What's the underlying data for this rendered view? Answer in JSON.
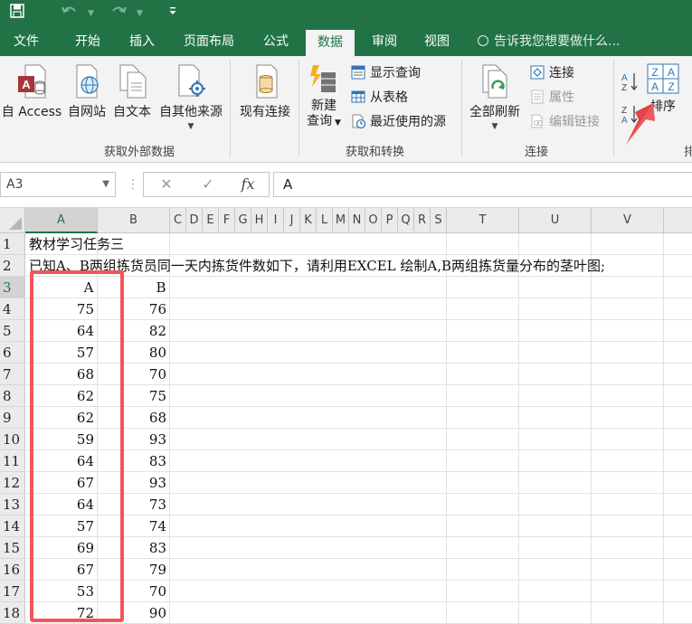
{
  "title_bar": {
    "quick_access": [
      "save-icon",
      "undo-icon",
      "redo-icon",
      "customize-icon"
    ]
  },
  "tabs": [
    {
      "label": "文件"
    },
    {
      "label": "开始"
    },
    {
      "label": "插入"
    },
    {
      "label": "页面布局"
    },
    {
      "label": "公式"
    },
    {
      "label": "数据",
      "active": true
    },
    {
      "label": "审阅"
    },
    {
      "label": "视图"
    }
  ],
  "tell_me": "告诉我您想要做什么...",
  "ribbon": {
    "get_external": {
      "label": "获取外部数据",
      "buttons": [
        "自 Access",
        "自网站",
        "自文本",
        "自其他来源"
      ],
      "existing": "现有连接"
    },
    "get_transform": {
      "label": "获取和转换",
      "new_query_line1": "新建",
      "new_query_line2": "查询",
      "show_queries": "显示查询",
      "from_table": "从表格",
      "recent_sources": "最近使用的源"
    },
    "connections": {
      "label": "连接",
      "refresh_all": "全部刷新",
      "connections": "连接",
      "properties": "属性",
      "edit_links": "编辑链接"
    },
    "sort": {
      "sort_label": "排序",
      "partial_group": "排"
    }
  },
  "formula_bar": {
    "name_box": "A3",
    "cancel": "✕",
    "enter": "✓",
    "fx": "fx",
    "content": "A"
  },
  "columns": [
    "A",
    "B",
    "C",
    "D",
    "E",
    "F",
    "G",
    "H",
    "I",
    "J",
    "K",
    "L",
    "M",
    "N",
    "O",
    "P",
    "Q",
    "R",
    "S",
    "T",
    "U",
    "V"
  ],
  "rows": [
    "1",
    "2",
    "3",
    "4",
    "5",
    "6",
    "7",
    "8",
    "9",
    "10",
    "11",
    "12",
    "13",
    "14",
    "15",
    "16",
    "17",
    "18"
  ],
  "cells": {
    "row1": "教材学习任务三",
    "row2": "已知A、B两组拣货员同一天内拣货件数如下，请利用EXCEL 绘制A,B两组拣货量分布的茎叶图;",
    "header_a": "A",
    "header_b": "B",
    "col_a": [
      "75",
      "64",
      "57",
      "68",
      "62",
      "62",
      "59",
      "64",
      "67",
      "64",
      "57",
      "69",
      "67",
      "53",
      "72"
    ],
    "col_b": [
      "76",
      "82",
      "80",
      "70",
      "75",
      "68",
      "93",
      "83",
      "93",
      "73",
      "74",
      "83",
      "79",
      "70",
      "90"
    ]
  },
  "colors": {
    "excel_green": "#217346",
    "highlight_red": "#f0575c"
  }
}
